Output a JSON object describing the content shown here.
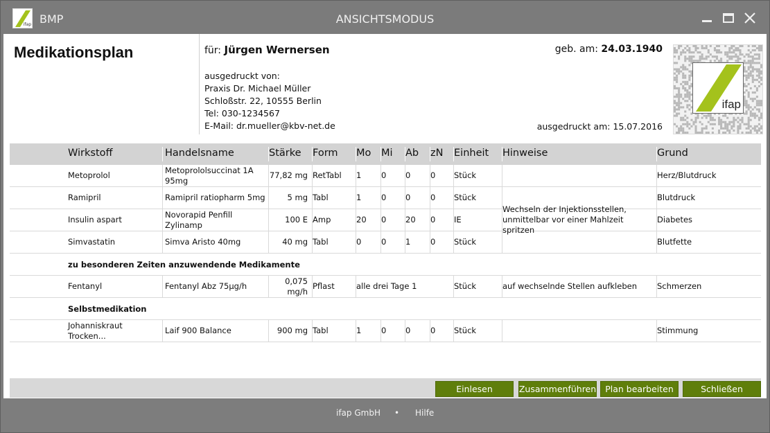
{
  "titlebar": {
    "app_name": "BMP",
    "mode": "ANSICHTSMODUS",
    "logo_text": "ifap",
    "accent": "#a4c21c"
  },
  "header": {
    "title": "Medikationsplan",
    "patient_label": "für:",
    "patient_name": "Jürgen Wernersen",
    "dob_label": "geb. am:",
    "dob": "24.03.1940",
    "printed_by_label": "ausgedruckt von:",
    "practice": "Praxis Dr. Michael Müller",
    "address": "Schloßstr. 22, 10555 Berlin",
    "phone": "Tel: 030-1234567",
    "email": "E-Mail: dr.mueller@kbv-net.de",
    "printed_on": "ausgedruckt am: 15.07.2016",
    "qr_logo_text": "ifap"
  },
  "table": {
    "columns": [
      "Wirkstoff",
      "Handelsname",
      "Stärke",
      "Form",
      "Mo",
      "Mi",
      "Ab",
      "zN",
      "Einheit",
      "Hinweise",
      "Grund"
    ],
    "rows": [
      {
        "wirkstoff": "Metoprolol",
        "handelsname": "Metoprololsuccinat 1A 95mg",
        "staerke": "77,82 mg",
        "form": "RetTabl",
        "mo": "1",
        "mi": "0",
        "ab": "0",
        "zn": "0",
        "einheit": "Stück",
        "hinweise": "",
        "grund": "Herz/Blutdruck"
      },
      {
        "wirkstoff": "Ramipril",
        "handelsname": "Ramipril ratiopharm 5mg",
        "staerke": "5 mg",
        "form": "Tabl",
        "mo": "1",
        "mi": "0",
        "ab": "0",
        "zn": "0",
        "einheit": "Stück",
        "hinweise": "",
        "grund": "Blutdruck"
      },
      {
        "wirkstoff": "Insulin aspart",
        "handelsname": "Novorapid Penfill Zylinamp",
        "staerke": "100 E",
        "form": "Amp",
        "mo": "20",
        "mi": "0",
        "ab": "20",
        "zn": "0",
        "einheit": "IE",
        "hinweise": "Wechseln der Injektionsstellen, unmittelbar vor einer Mahlzeit spritzen",
        "grund": "Diabetes"
      },
      {
        "wirkstoff": "Simvastatin",
        "handelsname": "Simva Aristo 40mg",
        "staerke": "40 mg",
        "form": "Tabl",
        "mo": "0",
        "mi": "0",
        "ab": "1",
        "zn": "0",
        "einheit": "Stück",
        "hinweise": "",
        "grund": "Blutfette"
      }
    ],
    "section_special": "zu besonderen Zeiten anzuwendende Medikamente",
    "special_rows": [
      {
        "wirkstoff": "Fentanyl",
        "handelsname": "Fentanyl Abz 75µg/h",
        "staerke": "0,075 mg/h",
        "form": "Pflast",
        "dosage_text": "alle drei Tage 1",
        "einheit": "Stück",
        "hinweise": "auf wechselnde Stellen aufkleben",
        "grund": "Schmerzen"
      }
    ],
    "section_self": "Selbstmedikation",
    "self_rows": [
      {
        "wirkstoff": "Johanniskraut Trocken...",
        "handelsname": "Laif 900 Balance",
        "staerke": "900 mg",
        "form": "Tabl",
        "mo": "1",
        "mi": "0",
        "ab": "0",
        "zn": "0",
        "einheit": "Stück",
        "hinweise": "",
        "grund": "Stimmung"
      }
    ]
  },
  "buttons": {
    "einlesen": "Einlesen",
    "zusammenfuehren": "Zusammenführen",
    "plan_bearbeiten": "Plan bearbeiten",
    "schliessen": "Schließen",
    "color": "#5f7e0b"
  },
  "footer": {
    "company": "ifap GmbH",
    "separator": "•",
    "help": "Hilfe"
  }
}
